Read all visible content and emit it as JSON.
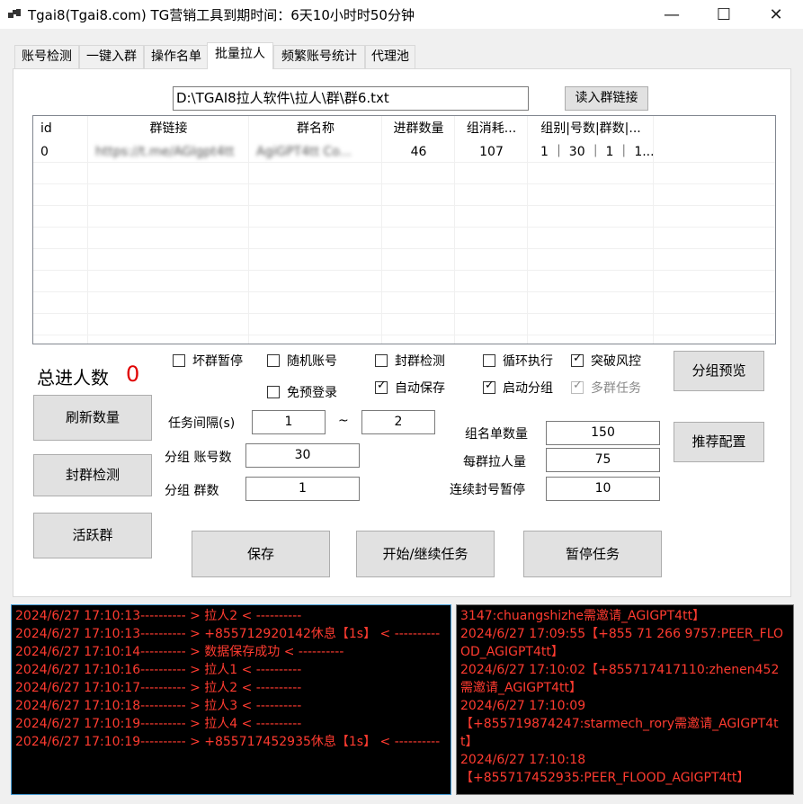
{
  "window": {
    "title": "Tgai8(Tgai8.com) TG营销工具到期时间：6天10小时时50分钟",
    "minimize": "—",
    "maximize": "☐",
    "close": "✕"
  },
  "tabs": [
    "账号检测",
    "一键入群",
    "操作名单",
    "批量拉人",
    "频繁账号统计",
    "代理池"
  ],
  "active_tab": "批量拉人",
  "file": {
    "path": "D:\\TGAI8拉人软件\\拉人\\群\\群6.txt",
    "load_button": "读入群链接"
  },
  "grid": {
    "columns": [
      "id",
      "群链接",
      "群名称",
      "进群数量",
      "组消耗...",
      "组别|号数|群数|..."
    ],
    "rows": [
      [
        "0",
        "https://t.me/AGIgpt4tt",
        "AgiGPT4tt Co...",
        "46",
        "107",
        "1 ｜ 30 ｜ 1 ｜ 1..."
      ]
    ]
  },
  "stats": {
    "total_label": "总进人数",
    "total_value": "0"
  },
  "buttons": {
    "refresh": "刷新数量",
    "ban_check": "封群检测",
    "active_group": "活跃群",
    "group_preview": "分组预览",
    "recommend": "推荐配置",
    "save": "保存",
    "start": "开始/继续任务",
    "pause": "暂停任务"
  },
  "options": {
    "bad_group_pause": {
      "label": "坏群暂停",
      "checked": false
    },
    "random_account": {
      "label": "随机账号",
      "checked": false
    },
    "ban_detect": {
      "label": "封群检测",
      "checked": false
    },
    "loop_exec": {
      "label": "循环执行",
      "checked": false
    },
    "break_risk": {
      "label": "突破风控",
      "checked": true
    },
    "no_pre_login": {
      "label": "免预登录",
      "checked": false
    },
    "auto_save": {
      "label": "自动保存",
      "checked": true
    },
    "auto_group": {
      "label": "启动分组",
      "checked": true
    },
    "multi_group_task": {
      "label": "多群任务",
      "checked": true,
      "disabled": true
    }
  },
  "settings": {
    "interval_label": "任务间隔(s)",
    "interval_min": "1",
    "interval_sep": "~",
    "interval_max": "2",
    "group_accounts_label": "分组 账号数",
    "group_accounts": "30",
    "group_groups_label": "分组 群数",
    "group_groups": "1",
    "group_list_label": "组名单数量",
    "group_list": "150",
    "per_group_label": "每群拉人量",
    "per_group": "75",
    "consecutive_ban_label": "连续封号暂停",
    "consecutive_ban": "10"
  },
  "log_left": [
    "2024/6/27 17:10:13---------- > 拉人2 < ----------",
    "2024/6/27 17:10:13---------- > +855712920142休息【1s】 < ----------",
    "2024/6/27 17:10:14---------- > 数据保存成功 < ----------",
    "2024/6/27 17:10:16---------- > 拉人1 < ----------",
    "2024/6/27 17:10:17---------- > 拉人2 < ----------",
    "2024/6/27 17:10:18---------- > 拉人3 < ----------",
    "2024/6/27 17:10:19---------- > 拉人4 < ----------",
    "2024/6/27 17:10:19---------- > +855717452935休息【1s】 < ----------"
  ],
  "log_right": [
    "3147:chuangshizhe需邀请_AGIGPT4tt】",
    "2024/6/27 17:09:55【+855 71 266 9757:PEER_FLOOD_AGIGPT4tt】",
    "2024/6/27 17:10:02【+855717417110:zhenen452需邀请_AGIGPT4tt】",
    "2024/6/27 17:10:09",
    "【+855719874247:starmech_rory需邀请_AGIGPT4tt】",
    "2024/6/27 17:10:18",
    "【+855717452935:PEER_FLOOD_AGIGPT4tt】"
  ]
}
